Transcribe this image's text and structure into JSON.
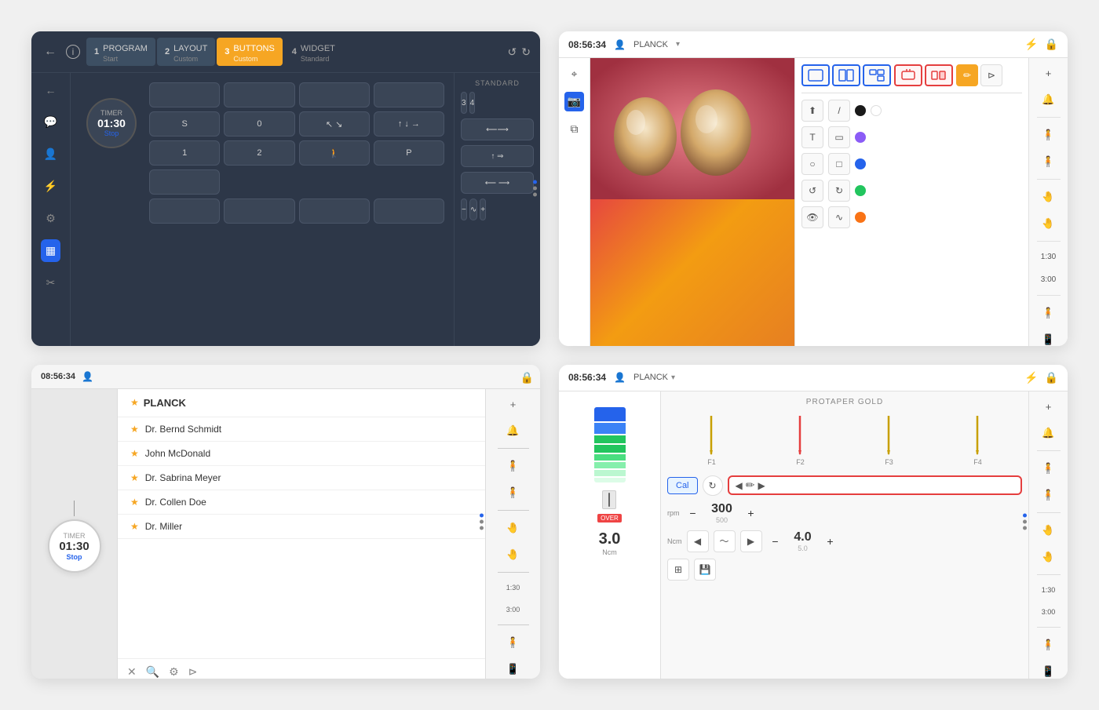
{
  "panel1": {
    "back_label": "←",
    "steps": [
      {
        "num": "1",
        "label": "PROGRAM",
        "sub": "Start",
        "state": "done"
      },
      {
        "num": "2",
        "label": "LAYOUT",
        "sub": "Custom",
        "state": "done"
      },
      {
        "num": "3",
        "label": "BUTTONS",
        "sub": "Custom",
        "state": "active"
      },
      {
        "num": "4",
        "label": "WIDGET",
        "sub": "Standard",
        "state": "normal"
      }
    ],
    "timer": {
      "label": "TIMER",
      "time": "01:30",
      "stop": "Stop"
    },
    "buttons_row1": [
      "S",
      "0"
    ],
    "buttons_row2": [
      "1",
      "2"
    ],
    "right_label": "STANDARD",
    "right_vals": [
      "3",
      "4"
    ]
  },
  "panel2": {
    "time": "08:56:34",
    "user": "PLANCK",
    "colors": {
      "black": "#1a1a1a",
      "white": "#ffffff",
      "purple": "#8b5cf6",
      "blue": "#2563eb",
      "green": "#22c55e",
      "orange": "#f97316"
    },
    "tools": [
      "cursor",
      "pen",
      "T",
      "circle",
      "rect",
      "undo",
      "redo",
      "eye",
      "wave"
    ]
  },
  "panel3": {
    "time": "08:56:34",
    "patients": [
      {
        "name": "PLANCK",
        "starred": true
      },
      {
        "name": "Dr. Bernd Schmidt",
        "starred": true
      },
      {
        "name": "John McDonald",
        "starred": true
      },
      {
        "name": "Dr. Sabrina Meyer",
        "starred": true
      },
      {
        "name": "Dr. Collen Doe",
        "starred": true
      },
      {
        "name": "Dr. Miller",
        "starred": true
      }
    ],
    "timer": {
      "label": "TIMER",
      "time": "01:30",
      "stop": "Stop"
    }
  },
  "panel4": {
    "time": "08:56:34",
    "user": "PLANCK",
    "product": "PROTAPER GOLD",
    "files": [
      "F1",
      "F2",
      "F3",
      "F4"
    ],
    "ncm_val": "3.0",
    "ncm_unit": "Ncm",
    "rpm_val": "300",
    "rpm_min": "500",
    "ncm_val2": "4.0",
    "ncm_val2_sub": "5.0",
    "cal_label": "Cal"
  }
}
